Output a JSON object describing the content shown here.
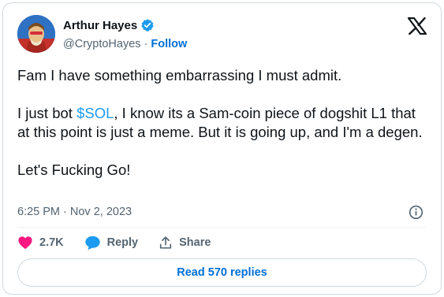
{
  "author": {
    "display_name": "Arthur Hayes",
    "handle": "@CryptoHayes",
    "separator": "·",
    "follow_label": "Follow"
  },
  "tweet": {
    "line1": "Fam I have something embarrassing I must admit.",
    "cashtag": "$SOL",
    "para2_before": "I just bot ",
    "para2_after": ", I know its a Sam-coin piece of dogshit L1 that at this point is just a meme. But it is going up, and I'm a degen.",
    "line3": "Let's Fucking Go!",
    "timestamp": "6:25 PM · Nov 2, 2023"
  },
  "actions": {
    "likes": "2.7K",
    "reply_label": "Reply",
    "share_label": "Share"
  },
  "read_replies_label": "Read 570 replies",
  "colors": {
    "accent": "#1d9bf0",
    "link": "#006fd6",
    "like": "#f91880",
    "muted": "#536471"
  },
  "icons": [
    "verified-badge-icon",
    "x-logo-icon",
    "info-icon",
    "heart-icon",
    "reply-bubble-icon",
    "share-icon"
  ]
}
